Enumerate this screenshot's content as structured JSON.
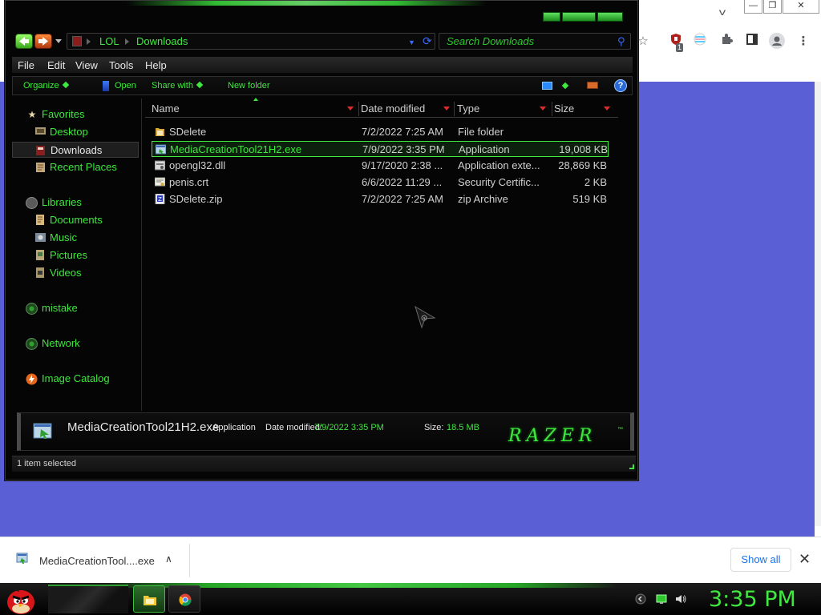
{
  "explorer": {
    "breadcrumbs": [
      "LOL",
      "Downloads"
    ],
    "search_placeholder": "Search Downloads",
    "menu": [
      "File",
      "Edit",
      "View",
      "Tools",
      "Help"
    ],
    "toolbar": {
      "organize": "Organize",
      "open": "Open",
      "share_with": "Share with",
      "new_folder": "New folder",
      "help": "?"
    },
    "nav": {
      "favorites": "Favorites",
      "desktop": "Desktop",
      "downloads": "Downloads",
      "recent_places": "Recent Places",
      "libraries": "Libraries",
      "documents": "Documents",
      "music": "Music",
      "pictures": "Pictures",
      "videos": "Videos",
      "mistake": "mistake",
      "network": "Network",
      "image_catalog": "Image Catalog"
    },
    "columns": {
      "name": "Name",
      "date_modified": "Date modified",
      "type": "Type",
      "size": "Size"
    },
    "files": [
      {
        "name": "SDelete",
        "date": "7/2/2022 7:25 AM",
        "type": "File folder",
        "size": "",
        "icon": "folder-icon"
      },
      {
        "name": "MediaCreationTool21H2.exe",
        "date": "7/9/2022 3:35 PM",
        "type": "Application",
        "size": "19,008 KB",
        "icon": "exe-icon"
      },
      {
        "name": "opengl32.dll",
        "date": "9/17/2020 2:38 ...",
        "type": "Application exte...",
        "size": "28,869 KB",
        "icon": "dll-icon"
      },
      {
        "name": "penis.crt",
        "date": "6/6/2022 11:29 ...",
        "type": "Security Certific...",
        "size": "2 KB",
        "icon": "certificate-icon"
      },
      {
        "name": "SDelete.zip",
        "date": "7/2/2022 7:25 AM",
        "type": "zip Archive",
        "size": "519 KB",
        "icon": "zip-icon"
      }
    ],
    "details": {
      "name": "MediaCreationTool21H2.exe",
      "type": "Application",
      "date_label": "Date modified:",
      "date_value": "7/9/2022 3:35 PM",
      "size_label": "Size:",
      "size_value": "18.5 MB",
      "brand": "RAZER",
      "brand_tm": "™"
    },
    "status": "1 item selected"
  },
  "browser": {
    "download_item": "MediaCreationTool....exe",
    "show_all": "Show all",
    "extension_badge": "1"
  },
  "taskbar": {
    "clock": "3:35 PM"
  },
  "colors": {
    "accent_green": "#3ee83e",
    "browser_bg": "#5a5fd6",
    "window_bg": "#050505"
  }
}
